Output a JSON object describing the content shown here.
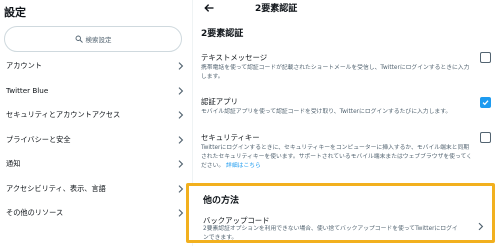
{
  "left": {
    "title": "設定",
    "search_placeholder": "検索設定",
    "items": [
      {
        "label": "アカウント"
      },
      {
        "label": "Twitter Blue"
      },
      {
        "label": "セキュリティとアカウントアクセス"
      },
      {
        "label": "プライバシーと安全"
      },
      {
        "label": "通知"
      },
      {
        "label": "アクセシビリティ、表示、言語"
      },
      {
        "label": "その他のリソース"
      }
    ]
  },
  "right": {
    "title": "2要素認証",
    "section_title": "2要素認証",
    "options": [
      {
        "label": "テキストメッセージ",
        "desc": "携帯電話を使って認証コードが記載されたショートメールを受信し、Twitterにログインするときに入力します。",
        "checked": false
      },
      {
        "label": "認証アプリ",
        "desc": "モバイル認証アプリを使って認証コードを受け取り、Twitterにログインするたびに入力します。",
        "checked": true
      },
      {
        "label": "セキュリティキー",
        "desc": "Twitterにログインするときに、セキュリティキーをコンピューターに挿入するか、モバイル端末と同期されたセキュリティキーを使います。サポートされているモバイル端末またはウェブブラウザを使ってください。",
        "link": "詳細はこちら",
        "checked": false
      }
    ],
    "other_methods": {
      "title": "他の方法",
      "backup_label": "バックアップコード",
      "backup_desc": "2要素認証オプションを利用できない場合、使い捨てバックアップコードを使ってTwitterにログインできます。"
    }
  },
  "colors": {
    "accent": "#1d9bf0",
    "highlight_border": "#f2b01e",
    "text_primary": "#0f1419",
    "text_secondary": "#536471"
  }
}
